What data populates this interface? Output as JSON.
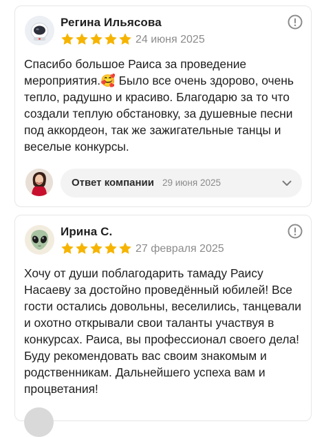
{
  "reviews": [
    {
      "author": "Регина Ильясова",
      "date": "24 июня 2025",
      "rating": 5,
      "avatar_icon": "astronaut-helmet-avatar",
      "text": "Спасибо большое Раиса за проведение мероприятия.🥰 Было все очень здорово, очень тепло, радушно и красиво.  Благодарю за то что создали теплую обстановку, за душевные песни под аккордеон, так же зажигательные танцы и веселые конкурсы.",
      "reply": {
        "label": "Ответ компании",
        "date": "29 июня 2025",
        "avatar_icon": "company-photo-avatar"
      }
    },
    {
      "author": "Ирина С.",
      "date": "27 февраля 2025",
      "rating": 5,
      "avatar_icon": "alien-emoji-avatar",
      "text": "Хочу от души поблагодарить тамаду Раису Насаеву за достойно проведённый юбилей! Все гости остались довольны, веселились, танцевали и охотно открывали свои таланты участвуя в конкурсах. Раиса, вы профессионал своего дела! Буду рекомендовать вас своим знакомым и родственникам. Дальнейшего успеха вам и процветания!"
    }
  ],
  "colors": {
    "star": "#f6b400",
    "muted_text": "#8b8b8b",
    "pill_bg": "#f3f3f3",
    "border": "#e6e6e6"
  },
  "icons": {
    "report": "exclamation-circle-icon",
    "expand": "chevron-down-icon",
    "star": "star-icon"
  }
}
